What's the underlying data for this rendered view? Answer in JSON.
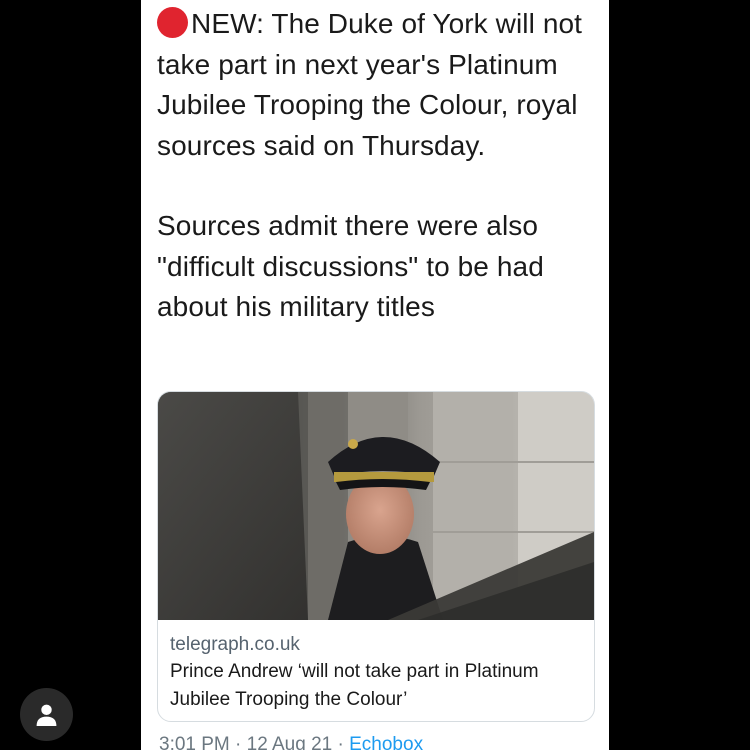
{
  "tweet": {
    "headline_prefix": "NEW:",
    "headline_rest": " The Duke of York will not take part in next year's Platinum Jubilee Trooping the Colour, royal sources said on Thursday.",
    "second_paragraph": "Sources admit there were also \"difficult discussions\" to be had about his military titles",
    "headline_icon": "red-circle-icon",
    "footer_time": "3:01 PM · 12 Aug 21 · ",
    "footer_source": "Echobox"
  },
  "link_card": {
    "domain": "telegraph.co.uk",
    "headline": "Prince Andrew ‘will not take part in Platinum Jubilee Trooping the Colour’",
    "image": "photo-of-man-in-military-peaked-cap"
  },
  "overlay": {
    "account_icon": "person-icon"
  },
  "colors": {
    "background": "#000000",
    "panel": "#ffffff",
    "red_dot": "#e0242f",
    "link": "#1d9bf0",
    "muted_text": "#56636f"
  }
}
